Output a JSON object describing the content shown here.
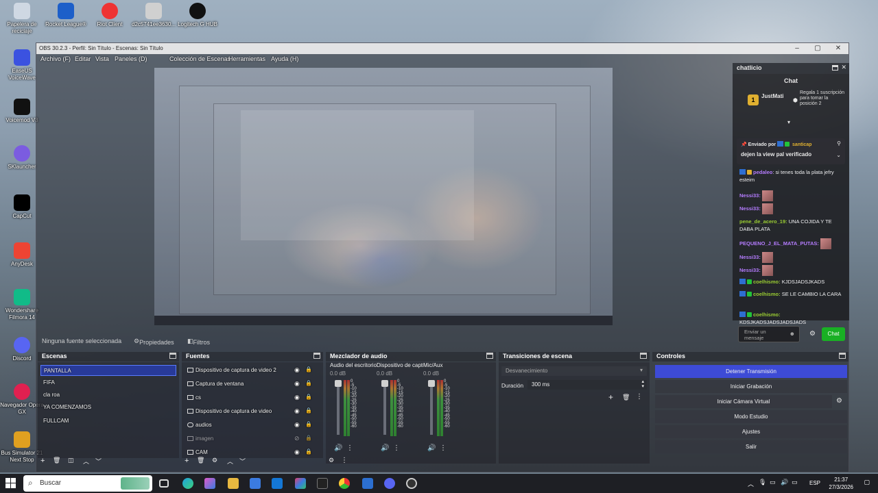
{
  "desktop": {
    "icons": [
      {
        "label": "Papelera de reciclaje",
        "icon": "recycle-bin-icon",
        "color": "#cfd8e3"
      },
      {
        "label": "Rocket League®",
        "icon": "rocket-league-icon",
        "color": "#1d5fc9"
      },
      {
        "label": "Riot Client",
        "icon": "riot-client-icon",
        "color": "#e33"
      },
      {
        "label": "d2c5741ee3630...",
        "icon": "file-icon",
        "color": "#d0d0d0"
      },
      {
        "label": "Logitech G HUB",
        "icon": "logitech-icon",
        "color": "#111"
      },
      {
        "label": "EaseUS VoiceWave",
        "icon": "easeus-icon",
        "color": "#3b52e0"
      },
      {
        "label": "Voicemod V3",
        "icon": "voicemod-icon",
        "color": "#111"
      },
      {
        "label": "SKlauncher",
        "icon": "sklauncher-icon",
        "color": "#7b5ce0"
      },
      {
        "label": "CapCut",
        "icon": "capcut-icon",
        "color": "#000"
      },
      {
        "label": "AnyDesk",
        "icon": "anydesk-icon",
        "color": "#e43"
      },
      {
        "label": "Wondershare Filmora 14",
        "icon": "filmora-icon",
        "color": "#1b8"
      },
      {
        "label": "Discord",
        "icon": "discord-icon",
        "color": "#5865f2"
      },
      {
        "label": "Navegador Opera GX",
        "icon": "opera-gx-icon",
        "color": "#e02050"
      },
      {
        "label": "Bus Simulator 21 Next Stop",
        "icon": "bus-simulator-icon",
        "color": "#e0a020"
      }
    ]
  },
  "obs": {
    "title": "OBS 30.2.3 - Perfil: Sin Título - Escenas: Sin Título",
    "menu": [
      "Archivo (F)",
      "Editar",
      "Vista",
      "Paneles (D)",
      "Colección de Escenas",
      "Herramientas",
      "Ayuda (H)"
    ],
    "context_bar": {
      "no_source": "Ninguna fuente seleccionada",
      "properties": "Propiedades",
      "filters": "Filtros"
    },
    "scenes": {
      "title": "Escenas",
      "items": [
        "PANTALLA",
        "FIFA",
        "cla roa",
        "YA COMENZAMOS",
        "FULLCAM"
      ],
      "active_index": 0
    },
    "sources": {
      "title": "Fuentes",
      "items": [
        {
          "label": "Dispositivo de captura de video 2",
          "icon": "video-capture-icon"
        },
        {
          "label": "Captura de ventana",
          "icon": "window-capture-icon"
        },
        {
          "label": "cs",
          "icon": "game-capture-icon"
        },
        {
          "label": "Dispositivo de captura de video",
          "icon": "video-capture-icon"
        },
        {
          "label": "audios",
          "icon": "audio-icon"
        },
        {
          "label": "imagen",
          "icon": "image-icon"
        },
        {
          "label": "CAM",
          "icon": "camera-icon"
        }
      ]
    },
    "mixer": {
      "title": "Mezclador de audio",
      "channels": [
        {
          "name": "Audio del escritorio",
          "db": "0.0 dB"
        },
        {
          "name": "Dispositivo de captura",
          "db": "0.0 dB"
        },
        {
          "name": "Mic/Aux",
          "db": "0.0 dB"
        }
      ],
      "scale": [
        "0",
        "-5",
        "-10",
        "-15",
        "-20",
        "-25",
        "-30",
        "-35",
        "-40",
        "-45",
        "-50",
        "-55",
        "-60"
      ]
    },
    "transitions": {
      "title": "Transiciones de escena",
      "type_value": "Desvanecimiento",
      "duration_label": "Duración",
      "duration_value": "300 ms"
    },
    "controls": {
      "title": "Controles",
      "buttons": [
        "Detener Transmisión",
        "Iniciar Grabación",
        "Iniciar Cámara Virtual",
        "Modo Estudio",
        "Ajustes",
        "Salir"
      ]
    }
  },
  "chat": {
    "dock_title": "chatlicio",
    "header": "Chat",
    "leaderboard": {
      "name": "JustMati",
      "rank": "1",
      "reward": "Regala 1 suscripción para tomar la posición 2"
    },
    "pinned": {
      "prefix": "Enviado por",
      "user": "santicap",
      "text": "dejen la view pal verificado"
    },
    "messages": [
      {
        "user": "pedaleo",
        "text": "si tenes toda la plata jefry esteim",
        "color": "#b57cff"
      },
      {
        "user": "Nessi33:",
        "text": "",
        "color": "#b57cff",
        "emote": true
      },
      {
        "user": "Nessi33:",
        "text": "",
        "color": "#b57cff",
        "emote": true
      },
      {
        "user": "pene_de_acero_19:",
        "text": "UNA COJIDA Y TE DABA PLATA",
        "color": "#9acd32"
      },
      {
        "user": "PEQUENO_J_EL_MATA_PUTAS:",
        "text": "",
        "color": "#b57cff",
        "emote": true
      },
      {
        "user": "Nessi33:",
        "text": "",
        "color": "#b57cff",
        "emote": true
      },
      {
        "user": "Nessi33:",
        "text": "",
        "color": "#b57cff",
        "emote": true
      },
      {
        "user": "coelhismo:",
        "text": "KJDSJADSJKADS",
        "color": "#9acd32"
      },
      {
        "user": "coelhismo:",
        "text": "SE LE CAMBIO LA CARA",
        "color": "#9acd32"
      },
      {
        "user": "coelhismo:",
        "text": "KDSJKADSJADSJADSJADS",
        "color": "#9acd32"
      }
    ],
    "input_placeholder": "Enviar un mensaje",
    "send_label": "Chat"
  },
  "taskbar": {
    "search_placeholder": "Buscar",
    "language": "ESP",
    "time": "21:37",
    "date": "27/3/2026"
  }
}
